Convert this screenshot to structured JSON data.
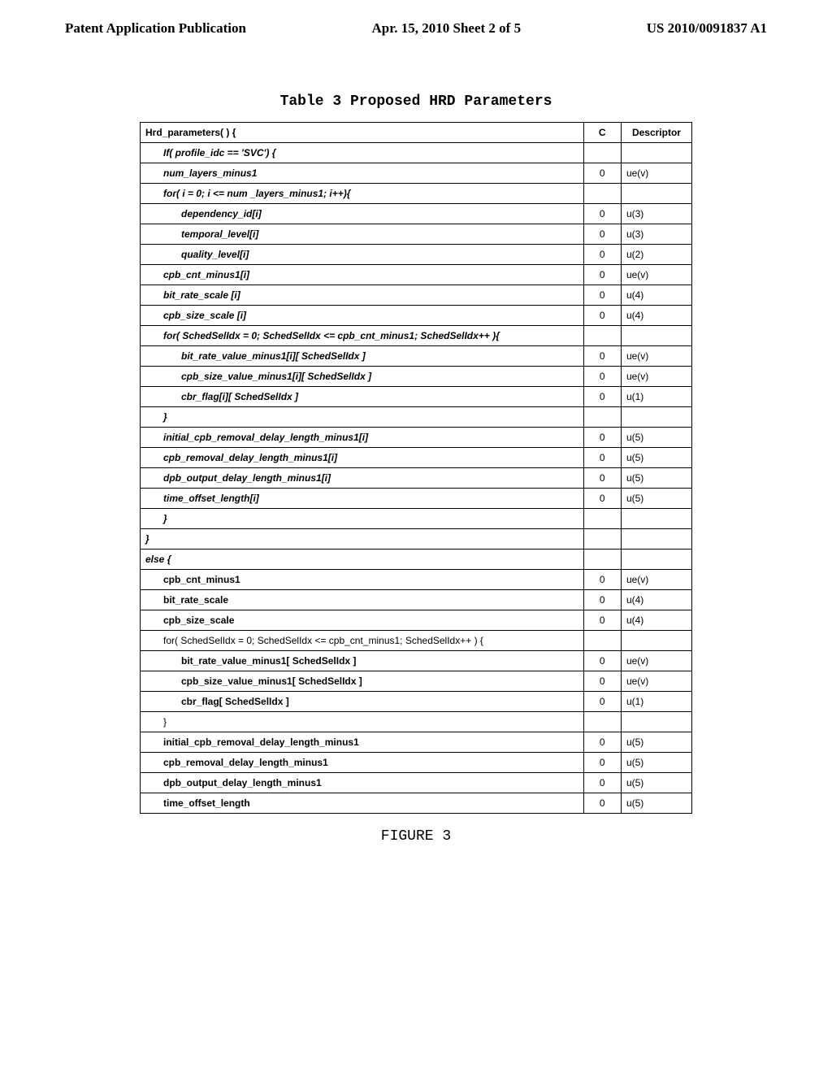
{
  "header": {
    "left": "Patent Application Publication",
    "center": "Apr. 15, 2010  Sheet 2 of 5",
    "right": "US 2010/0091837 A1"
  },
  "table_title": "Table 3 Proposed HRD Parameters",
  "figure_caption": "FIGURE 3",
  "hdr": {
    "c0": "Hrd_parameters( ) {",
    "c1": "C",
    "c2": "Descriptor"
  },
  "rows": [
    {
      "t": "If( profile_idc == 'SVC') {",
      "c": "",
      "d": "",
      "cls": "em indent1"
    },
    {
      "t": "num_layers_minus1",
      "c": "0",
      "d": "ue(v)",
      "cls": "em indent1"
    },
    {
      "t": "for( i = 0; i <= num _layers_minus1; i++){",
      "c": "",
      "d": "",
      "cls": "em indent1"
    },
    {
      "t": "dependency_id[i]",
      "c": "0",
      "d": "u(3)",
      "cls": "em indent2"
    },
    {
      "t": "temporal_level[i]",
      "c": "0",
      "d": "u(3)",
      "cls": "em indent2"
    },
    {
      "t": "quality_level[i]",
      "c": "0",
      "d": "u(2)",
      "cls": "em indent2"
    },
    {
      "t": "cpb_cnt_minus1[i]",
      "c": "0",
      "d": "ue(v)",
      "cls": "em indent1"
    },
    {
      "t": "bit_rate_scale [i]",
      "c": "0",
      "d": "u(4)",
      "cls": "em indent1"
    },
    {
      "t": "cpb_size_scale [i]",
      "c": "0",
      "d": "u(4)",
      "cls": "em indent1"
    },
    {
      "t": "for( SchedSelIdx = 0; SchedSelIdx <= cpb_cnt_minus1; SchedSelIdx++ ){",
      "c": "",
      "d": "",
      "cls": "em indent1"
    },
    {
      "t": "bit_rate_value_minus1[i][ SchedSelIdx ]",
      "c": "0",
      "d": "ue(v)",
      "cls": "em indent2"
    },
    {
      "t": "cpb_size_value_minus1[i][ SchedSelIdx ]",
      "c": "0",
      "d": "ue(v)",
      "cls": "em indent2"
    },
    {
      "t": "cbr_flag[i][ SchedSelIdx ]",
      "c": "0",
      "d": "u(1)",
      "cls": "em indent2"
    },
    {
      "t": "}",
      "c": "",
      "d": "",
      "cls": "em indent1"
    },
    {
      "t": "initial_cpb_removal_delay_length_minus1[i]",
      "c": "0",
      "d": "u(5)",
      "cls": "em indent1"
    },
    {
      "t": "cpb_removal_delay_length_minus1[i]",
      "c": "0",
      "d": "u(5)",
      "cls": "em indent1"
    },
    {
      "t": "dpb_output_delay_length_minus1[i]",
      "c": "0",
      "d": "u(5)",
      "cls": "em indent1"
    },
    {
      "t": "time_offset_length[i]",
      "c": "0",
      "d": "u(5)",
      "cls": "em indent1"
    },
    {
      "t": "}",
      "c": "",
      "d": "",
      "cls": "em indent1"
    },
    {
      "t": "}",
      "c": "",
      "d": "",
      "cls": "em"
    },
    {
      "t": "else {",
      "c": "",
      "d": "",
      "cls": "em"
    },
    {
      "t": "cpb_cnt_minus1",
      "c": "0",
      "d": "ue(v)",
      "cls": "bold indent1"
    },
    {
      "t": "bit_rate_scale",
      "c": "0",
      "d": "u(4)",
      "cls": "bold indent1"
    },
    {
      "t": "cpb_size_scale",
      "c": "0",
      "d": "u(4)",
      "cls": "bold indent1"
    },
    {
      "t": "for( SchedSelIdx = 0; SchedSelIdx <= cpb_cnt_minus1; SchedSelIdx++ ) {",
      "c": "",
      "d": "",
      "cls": "indent1"
    },
    {
      "t": "bit_rate_value_minus1[ SchedSelIdx ]",
      "c": "0",
      "d": "ue(v)",
      "cls": "bold indent2"
    },
    {
      "t": "cpb_size_value_minus1[ SchedSelIdx ]",
      "c": "0",
      "d": "ue(v)",
      "cls": "bold indent2"
    },
    {
      "t": "cbr_flag[ SchedSelIdx ]",
      "c": "0",
      "d": "u(1)",
      "cls": "bold indent2"
    },
    {
      "t": "}",
      "c": "",
      "d": "",
      "cls": "indent1"
    },
    {
      "t": "initial_cpb_removal_delay_length_minus1",
      "c": "0",
      "d": "u(5)",
      "cls": "bold indent1"
    },
    {
      "t": "cpb_removal_delay_length_minus1",
      "c": "0",
      "d": "u(5)",
      "cls": "bold indent1"
    },
    {
      "t": "dpb_output_delay_length_minus1",
      "c": "0",
      "d": "u(5)",
      "cls": "bold indent1"
    },
    {
      "t": "time_offset_length",
      "c": "0",
      "d": "u(5)",
      "cls": "bold indent1"
    }
  ]
}
